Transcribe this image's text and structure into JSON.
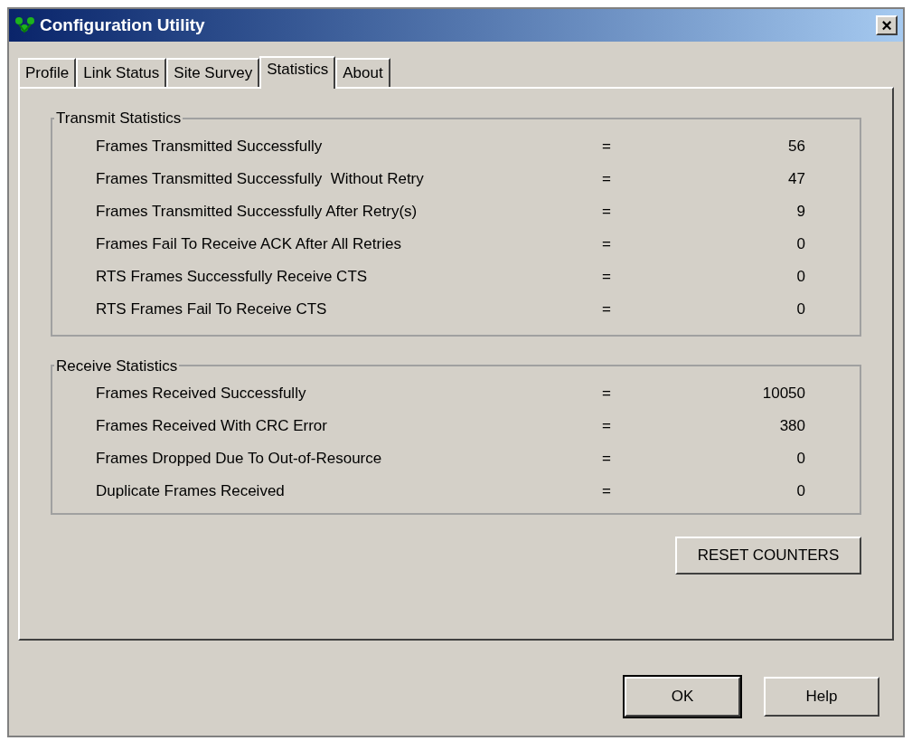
{
  "window": {
    "title": "Configuration Utility",
    "close": "×"
  },
  "tabs": [
    {
      "label": "Profile",
      "selected": false
    },
    {
      "label": "Link Status",
      "selected": false
    },
    {
      "label": "Site Survey",
      "selected": false
    },
    {
      "label": "Statistics",
      "selected": true
    },
    {
      "label": "About",
      "selected": false
    }
  ],
  "groups": [
    {
      "title": "Transmit Statistics",
      "rows": [
        {
          "label": "Frames Transmitted Successfully",
          "sign": "=",
          "value": "56"
        },
        {
          "label": "Frames Transmitted Successfully  Without Retry",
          "sign": "=",
          "value": "47"
        },
        {
          "label": "Frames Transmitted Successfully After Retry(s)",
          "sign": "=",
          "value": "9"
        },
        {
          "label": "Frames Fail To Receive ACK After All Retries",
          "sign": "=",
          "value": "0"
        },
        {
          "label": "RTS Frames Successfully Receive CTS",
          "sign": "=",
          "value": "0"
        },
        {
          "label": "RTS Frames Fail To Receive CTS",
          "sign": "=",
          "value": "0"
        }
      ]
    },
    {
      "title": "Receive Statistics",
      "rows": [
        {
          "label": "Frames Received Successfully",
          "sign": "=",
          "value": "10050"
        },
        {
          "label": "Frames Received With CRC Error",
          "sign": "=",
          "value": "380"
        },
        {
          "label": "Frames Dropped Due To Out-of-Resource",
          "sign": "=",
          "value": "0"
        },
        {
          "label": "Duplicate Frames Received",
          "sign": "=",
          "value": "0"
        }
      ]
    }
  ],
  "reset_button": "RESET COUNTERS",
  "buttons": [
    {
      "label": "OK",
      "default": true
    },
    {
      "label": "Help",
      "default": false
    }
  ]
}
